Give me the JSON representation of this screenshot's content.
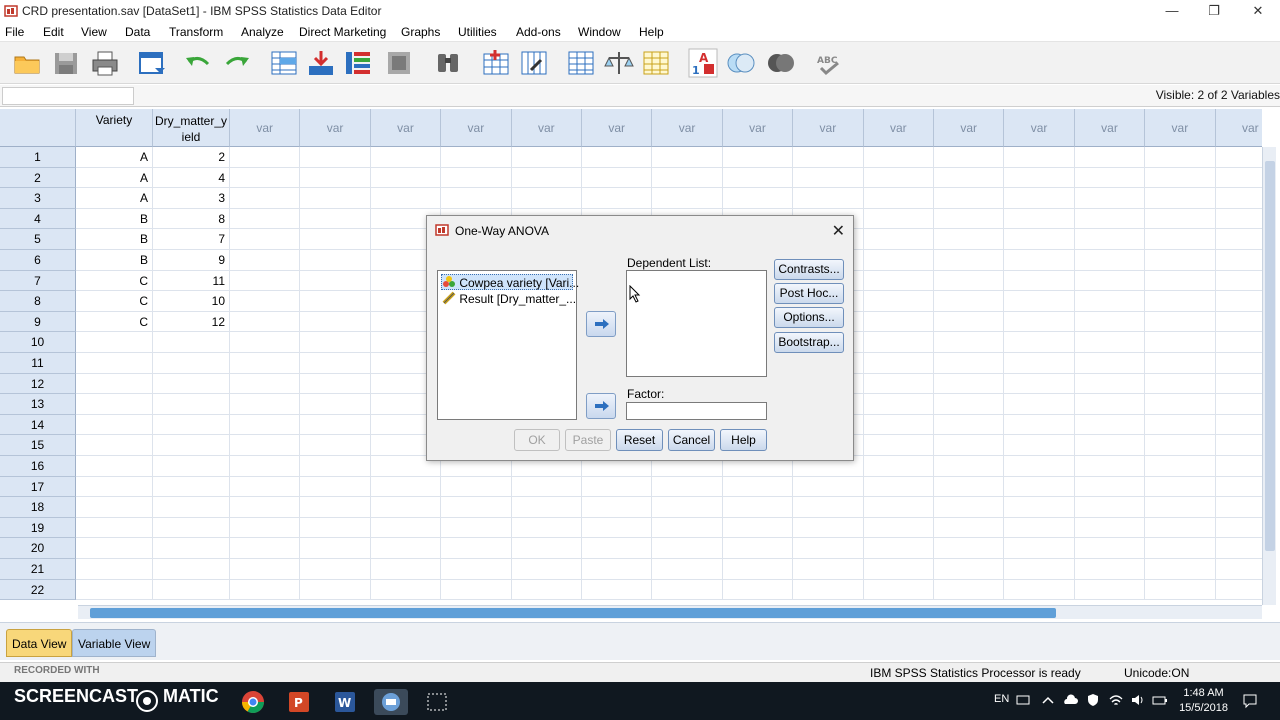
{
  "window": {
    "title": "CRD presentation.sav [DataSet1] - IBM SPSS Statistics Data Editor",
    "minimize_glyph": "—",
    "restore_glyph": "❐",
    "close_glyph": "✕"
  },
  "menu": [
    "File",
    "Edit",
    "View",
    "Data",
    "Transform",
    "Analyze",
    "Direct Marketing",
    "Graphs",
    "Utilities",
    "Add-ons",
    "Window",
    "Help"
  ],
  "toolbar_icons": [
    "open-folder-icon",
    "save-icon",
    "print-icon",
    "dialog-recall-icon",
    "undo-icon",
    "redo-icon",
    "goto-case-icon",
    "goto-variable-icon",
    "variables-icon",
    "run-descriptives-icon",
    "find-icon",
    "insert-cases-icon",
    "insert-variable-icon",
    "split-file-icon",
    "weight-cases-icon",
    "select-cases-icon",
    "value-labels-icon",
    "use-sets-icon",
    "show-all-variables-icon",
    "spell-check-icon"
  ],
  "cellbar": {
    "visible_text": "Visible: 2 of 2 Variables"
  },
  "grid": {
    "columns": [
      "Variety",
      "Dry_matter_yield",
      "var",
      "var",
      "var",
      "var",
      "var",
      "var",
      "var",
      "var",
      "var",
      "var",
      "var",
      "var",
      "var",
      "var",
      "var"
    ],
    "column2_lines": [
      "Dry_matter_y",
      "ield"
    ],
    "rows": [
      [
        "1",
        "A",
        "2"
      ],
      [
        "2",
        "A",
        "4"
      ],
      [
        "3",
        "A",
        "3"
      ],
      [
        "4",
        "B",
        "8"
      ],
      [
        "5",
        "B",
        "7"
      ],
      [
        "6",
        "B",
        "9"
      ],
      [
        "7",
        "C",
        "11"
      ],
      [
        "8",
        "C",
        "10"
      ],
      [
        "9",
        "C",
        "12"
      ],
      [
        "10",
        "",
        ""
      ],
      [
        "11",
        "",
        ""
      ],
      [
        "12",
        "",
        ""
      ],
      [
        "13",
        "",
        ""
      ],
      [
        "14",
        "",
        ""
      ],
      [
        "15",
        "",
        ""
      ],
      [
        "16",
        "",
        ""
      ],
      [
        "17",
        "",
        ""
      ],
      [
        "18",
        "",
        ""
      ],
      [
        "19",
        "",
        ""
      ],
      [
        "20",
        "",
        ""
      ],
      [
        "21",
        "",
        ""
      ],
      [
        "22",
        "",
        ""
      ]
    ]
  },
  "tabs": {
    "data_view": "Data View",
    "variable_view": "Variable View"
  },
  "status": {
    "processor": "IBM SPSS Statistics Processor is ready",
    "unicode": "Unicode:ON",
    "recorded_with": "RECORDED WITH",
    "screencast": "SCREENCAST",
    "matic": "MATIC"
  },
  "taskbar": {
    "lang": "EN",
    "time": "1:48 AM",
    "date": "15/5/2018"
  },
  "dialog": {
    "title": "One-Way ANOVA",
    "source_items": [
      "Cowpea variety [Vari...",
      "Result [Dry_matter_..."
    ],
    "dependent_label": "Dependent List:",
    "factor_label": "Factor:",
    "side_buttons": [
      "Contrasts...",
      "Post Hoc...",
      "Options...",
      "Bootstrap..."
    ],
    "ok": "OK",
    "paste": "Paste",
    "reset": "Reset",
    "cancel": "Cancel",
    "help": "Help"
  },
  "colors": {
    "accent": "#5f9fd8",
    "header_bg": "#dbe6f4",
    "selected_item": "#3399ff",
    "taskbar": "#101820"
  }
}
